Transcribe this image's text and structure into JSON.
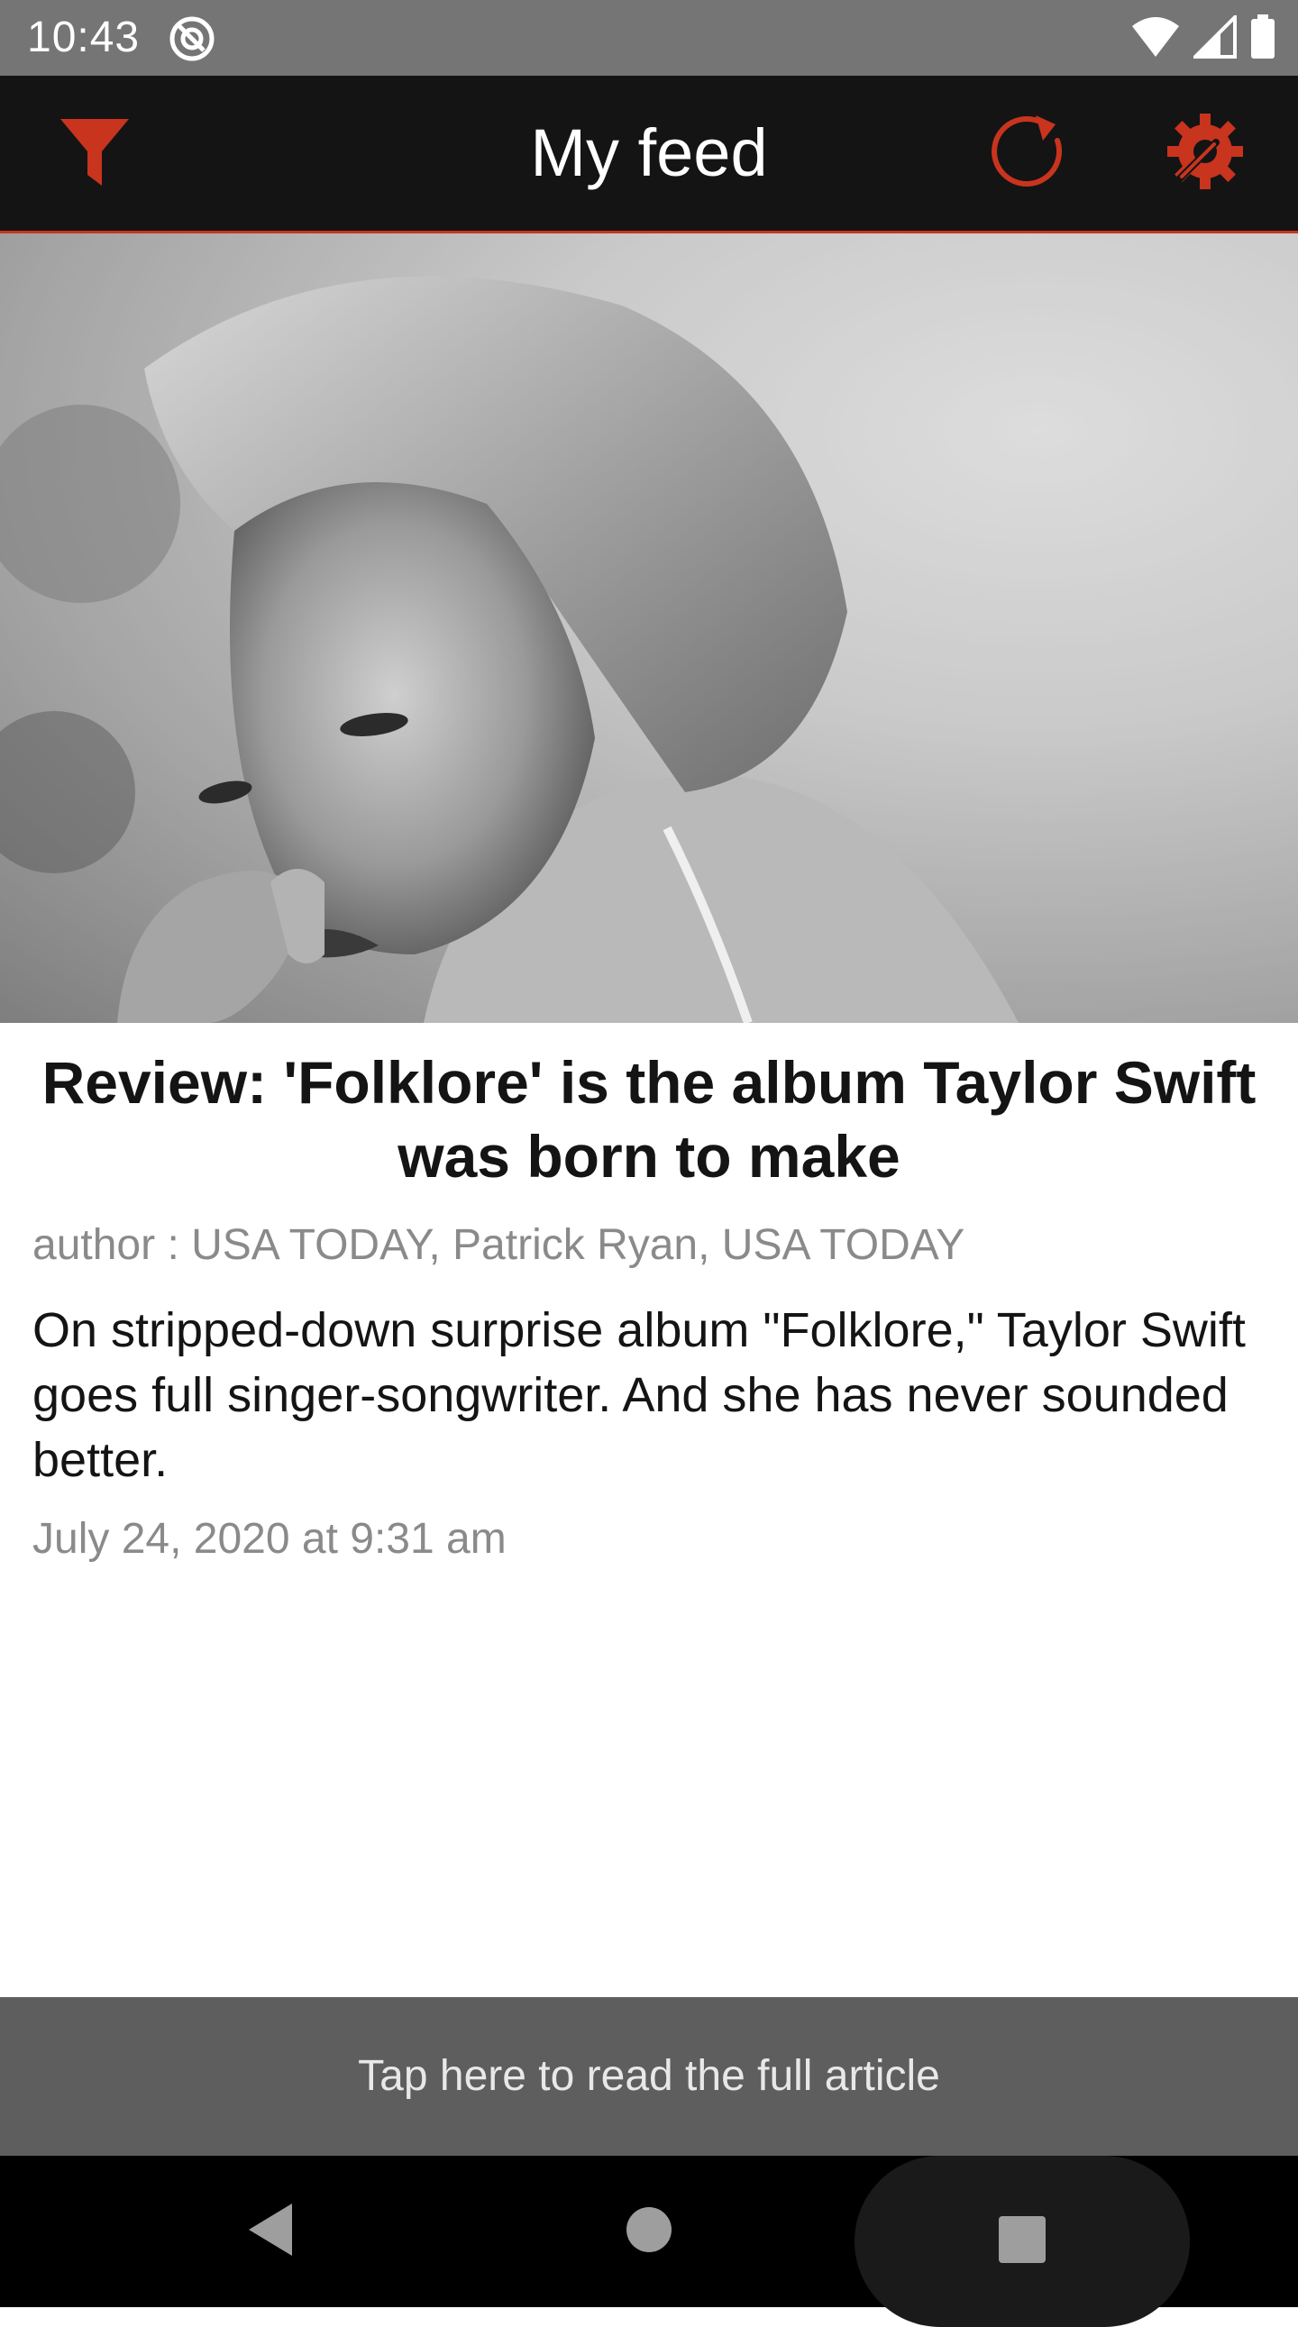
{
  "status_bar": {
    "time": "10:43",
    "icons": [
      "sync-icon",
      "wifi-icon",
      "signal-icon",
      "battery-icon"
    ]
  },
  "app_bar": {
    "title": "My feed",
    "accent_color": "#c8341e",
    "icons": [
      "filter-icon",
      "refresh-icon",
      "settings-icon"
    ]
  },
  "article": {
    "image_alt": "Black and white portrait",
    "headline": "Review: 'Folklore' is the album Taylor Swift was born to make",
    "author": "author : USA TODAY, Patrick Ryan, USA TODAY",
    "summary": "On stripped-down surprise album \"Folklore,\" Taylor Swift goes full singer-songwriter. And she has never sounded better.",
    "date": "July 24, 2020 at 9:31 am"
  },
  "read_full_label": "Tap here to read the full article",
  "nav_bar": {
    "icons": [
      "back-icon",
      "home-icon",
      "recents-icon"
    ]
  }
}
